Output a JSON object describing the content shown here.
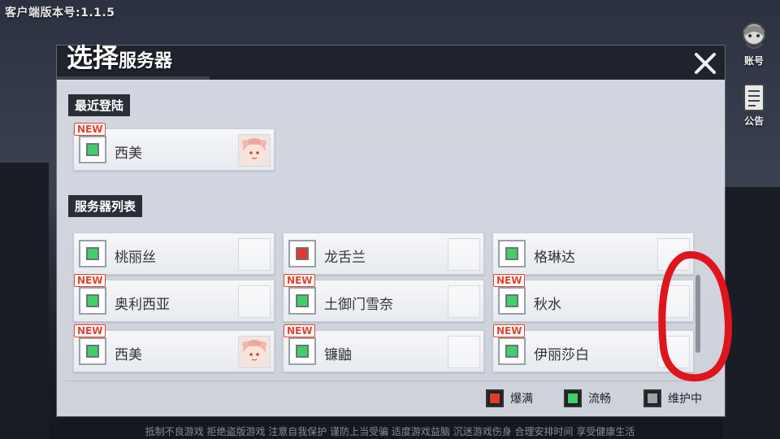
{
  "version_text": "客户端版本号:1.1.5",
  "side": {
    "account_label": "账号",
    "notice_label": "公告"
  },
  "dialog": {
    "title_big": "选择",
    "title_small": "服务器",
    "recent_label": "最近登陆",
    "list_label": "服务器列表"
  },
  "recent": [
    {
      "name": "西美",
      "status": "smooth",
      "is_new": true,
      "has_avatar": true,
      "new_label": "NEW"
    }
  ],
  "servers": [
    {
      "name": "桃丽丝",
      "status": "smooth",
      "is_new": false,
      "has_avatar": false
    },
    {
      "name": "龙舌兰",
      "status": "full",
      "is_new": false,
      "has_avatar": false
    },
    {
      "name": "格琳达",
      "status": "smooth",
      "is_new": false,
      "has_avatar": false
    },
    {
      "name": "奥利西亚",
      "status": "smooth",
      "is_new": true,
      "has_avatar": false,
      "new_label": "NEW"
    },
    {
      "name": "土御门雪奈",
      "status": "smooth",
      "is_new": true,
      "has_avatar": false,
      "new_label": "NEW"
    },
    {
      "name": "秋水",
      "status": "smooth",
      "is_new": true,
      "has_avatar": false,
      "new_label": "NEW"
    },
    {
      "name": "西美",
      "status": "smooth",
      "is_new": true,
      "has_avatar": true,
      "new_label": "NEW"
    },
    {
      "name": "镰鼬",
      "status": "smooth",
      "is_new": true,
      "has_avatar": false,
      "new_label": "NEW"
    },
    {
      "name": "伊丽莎白",
      "status": "smooth",
      "is_new": true,
      "has_avatar": false,
      "new_label": "NEW"
    }
  ],
  "legend": {
    "full_label": "爆满",
    "smooth_label": "流畅",
    "maintenance_label": "维护中"
  },
  "colors": {
    "full": "#e03a2c",
    "smooth": "#3fd06a",
    "maintenance": "#9ea3aa",
    "scribble": "#e0141c"
  },
  "footer": {
    "line": "抵制不良游戏  拒绝盗版游戏  注意自我保护  谨防上当受骗  适度游戏益脑  沉迷游戏伤身  合理安排时间  享受健康生活"
  }
}
